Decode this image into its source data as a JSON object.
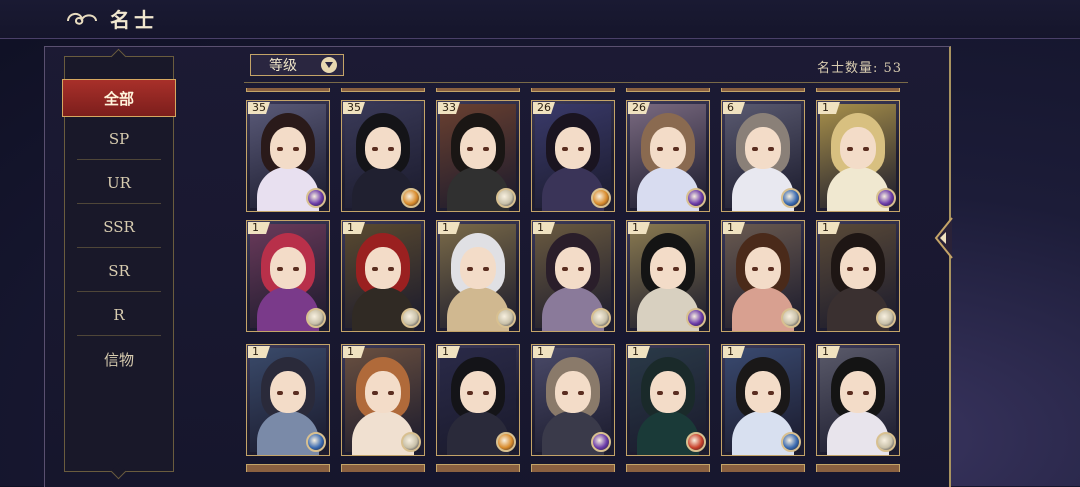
{
  "header": {
    "title": "名士",
    "icon": "cloud-swirl-icon"
  },
  "sidebar": {
    "categories": [
      {
        "label": "全部",
        "active": true
      },
      {
        "label": "SP",
        "active": false
      },
      {
        "label": "UR",
        "active": false
      },
      {
        "label": "SSR",
        "active": false
      },
      {
        "label": "SR",
        "active": false
      },
      {
        "label": "R",
        "active": false
      },
      {
        "label": "信物",
        "active": false
      }
    ]
  },
  "filter": {
    "sort_label": "等级",
    "count_label": "名士数量: 53"
  },
  "colors": {
    "accent_red": "#a8302a",
    "gold": "#c4a468",
    "panel": "#191829"
  },
  "cards": [
    {
      "level": "35",
      "hair": "#2a1a1a",
      "bg": "#5a5a78",
      "robe": "#e8e0f0",
      "badge": "#6a3aa8"
    },
    {
      "level": "35",
      "hair": "#141418",
      "bg": "#3a3a58",
      "robe": "#202030",
      "badge": "#d88a2a"
    },
    {
      "level": "33",
      "hair": "#1a1614",
      "bg": "#6a4030",
      "robe": "#303030",
      "badge": "#c8c0a8"
    },
    {
      "level": "26",
      "hair": "#1a1420",
      "bg": "#3a3a6a",
      "robe": "#3a3458",
      "badge": "#d88a2a"
    },
    {
      "level": "26",
      "hair": "#8a6a50",
      "bg": "#7a6a80",
      "robe": "#d8dcf0",
      "badge": "#6a3aa8"
    },
    {
      "level": "6",
      "hair": "#8a8078",
      "bg": "#5a5a70",
      "robe": "#e8e8f0",
      "badge": "#3a6ab0"
    },
    {
      "level": "1",
      "hair": "#d8c080",
      "bg": "#a8904a",
      "robe": "#f0e8d0",
      "badge": "#6a3aa8"
    },
    {
      "level": "1",
      "hair": "#b8304a",
      "bg": "#6a3a5a",
      "robe": "#7a3a8a",
      "badge": "#c8c0a8"
    },
    {
      "level": "1",
      "hair": "#9a2020",
      "bg": "#5a4a30",
      "robe": "#302a24",
      "badge": "#c8c0a8"
    },
    {
      "level": "1",
      "hair": "#e0e0e4",
      "bg": "#7a6a48",
      "robe": "#d0b890",
      "badge": "#c8c0a8"
    },
    {
      "level": "1",
      "hair": "#2a1e2a",
      "bg": "#6a5a40",
      "robe": "#8a7a9a",
      "badge": "#c8c0a8"
    },
    {
      "level": "1",
      "hair": "#141414",
      "bg": "#8a7a50",
      "robe": "#d8d0c0",
      "badge": "#6a3aa8"
    },
    {
      "level": "1",
      "hair": "#4a2a1a",
      "bg": "#6a5a50",
      "robe": "#d8a090",
      "badge": "#c8c0a8"
    },
    {
      "level": "1",
      "hair": "#1e1614",
      "bg": "#5a4a38",
      "robe": "#3a3030",
      "badge": "#c8c0a8"
    },
    {
      "level": "1",
      "hair": "#2a2a3a",
      "bg": "#3a4a6a",
      "robe": "#7a8aa8",
      "badge": "#3a6ab0"
    },
    {
      "level": "1",
      "hair": "#b06a3a",
      "bg": "#6a5040",
      "robe": "#f0e0d0",
      "badge": "#c8c0a8"
    },
    {
      "level": "1",
      "hair": "#141418",
      "bg": "#2a2a48",
      "robe": "#2a2a3a",
      "badge": "#d88a2a"
    },
    {
      "level": "1",
      "hair": "#8a7a6a",
      "bg": "#4a4a68",
      "robe": "#3a3a4a",
      "badge": "#6a3aa8"
    },
    {
      "level": "1",
      "hair": "#1a2a2a",
      "bg": "#2a3a48",
      "robe": "#1a3a38",
      "badge": "#c8402a"
    },
    {
      "level": "1",
      "hair": "#1a1818",
      "bg": "#3a4a70",
      "robe": "#d8e0f0",
      "badge": "#3a6ab0"
    },
    {
      "level": "1",
      "hair": "#141414",
      "bg": "#5a5a6a",
      "robe": "#e8e4ec",
      "badge": "#c8c0a8"
    }
  ]
}
